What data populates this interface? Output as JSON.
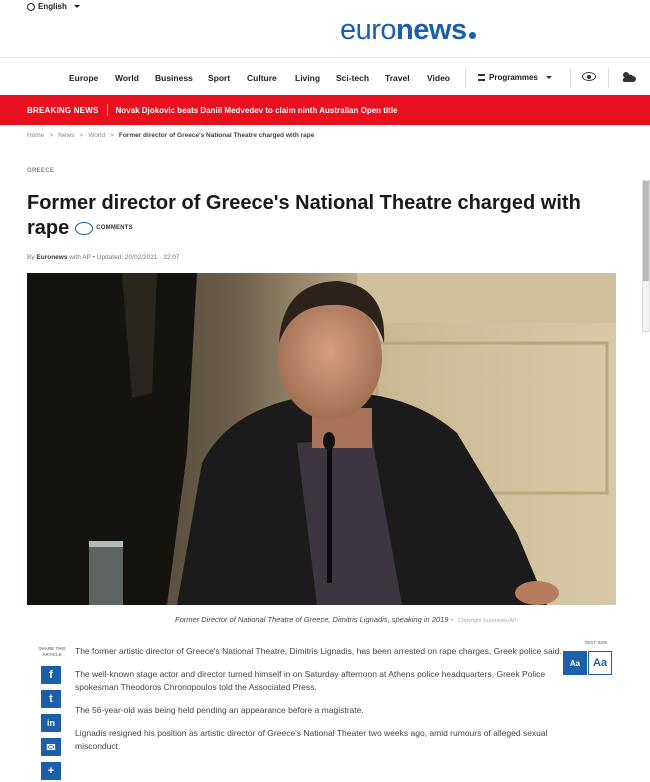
{
  "header": {
    "language": "English",
    "logo_a": "euro",
    "logo_b": "news"
  },
  "nav": {
    "items": [
      "Europe",
      "World",
      "Business",
      "Sport",
      "Culture",
      "Living",
      "Sci-tech",
      "Travel",
      "Video"
    ],
    "programmes": "Programmes",
    "icons": [
      "eye-icon",
      "weather-icon"
    ]
  },
  "breaking": {
    "label": "BREAKING NEWS",
    "text": "Novak Djokovic beats Daniil Medvedev to claim ninth Australian Open title"
  },
  "breadcrumb": {
    "items": [
      "Home",
      "News",
      "World"
    ],
    "current": "Former director of Greece's National Theatre charged with rape"
  },
  "article": {
    "section": "GREECE",
    "title": "Former director of Greece's National Theatre charged with rape",
    "comments_label": "COMMENTS",
    "byline_prefix": "By",
    "author": "Euronews",
    "with": "with AP",
    "updated": "Updated: 20/02/2021 - 22:07",
    "caption": "Former Director of National Theatre of Greece, Dimitris Lignadis, speaking in 2019",
    "caption_credit": "Copyright Euronews/AP",
    "share_label": "SHARE THIS ARTICLE",
    "textsize_label": "TEXT SIZE",
    "textsize_small": "Aa",
    "textsize_big": "Aa",
    "paragraphs": [
      "The former artistic director of Greece's National Theatre, Dimitris Lignadis, has been arrested on rape charges, Greek police said.",
      "The well-known stage actor and director turned himself in on Saturday afternoon at Athens police headquarters, Greek Police spokesman Theodoros Chronopoulos told the Associated Press.",
      "The 56-year-old was being held pending an appearance before a magistrate.",
      "Lignadis resigned his position as artistic director of Greece's National Theater two weeks ago, amid rumours of alleged sexual misconduct."
    ]
  },
  "colors": {
    "brand": "#1c5fa8",
    "breaking": "#e8101e"
  }
}
